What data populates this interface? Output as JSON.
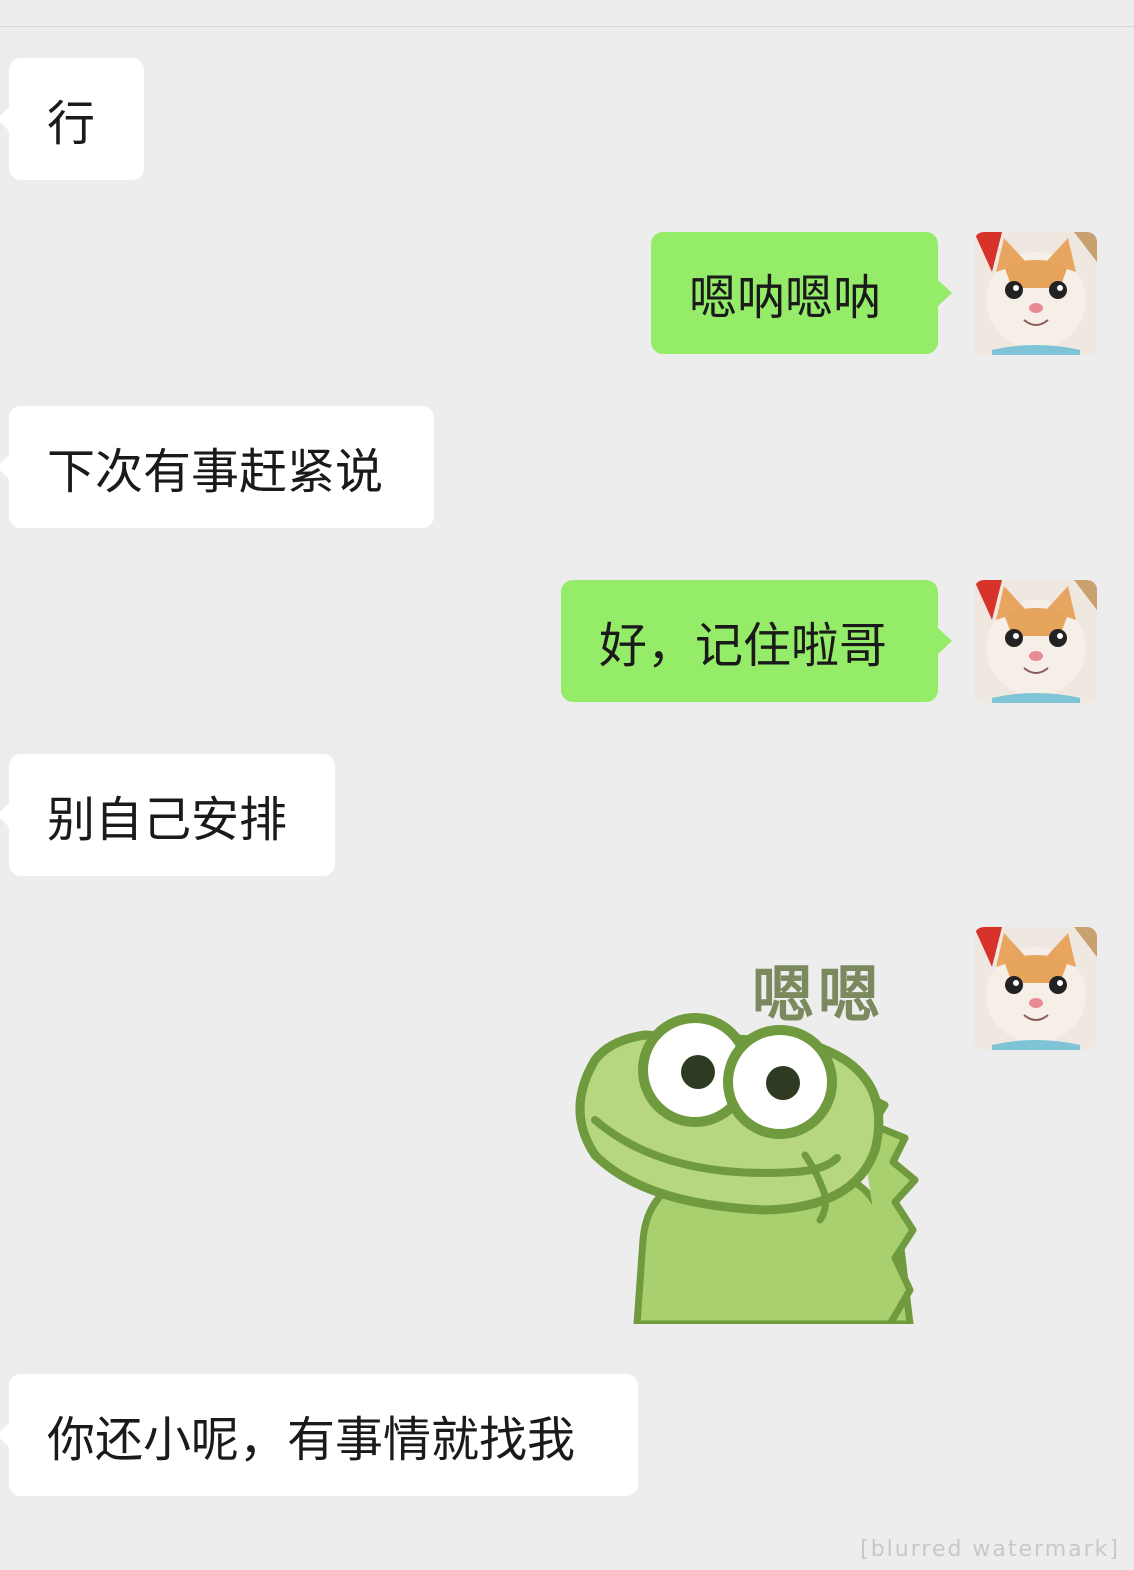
{
  "messages": [
    {
      "side": "left",
      "text": "行"
    },
    {
      "side": "right",
      "text": "嗯呐嗯呐"
    },
    {
      "side": "left",
      "text": "下次有事赶紧说"
    },
    {
      "side": "right",
      "text": "好，记住啦哥"
    },
    {
      "side": "left",
      "text": "别自己安排"
    },
    {
      "side": "right",
      "type": "sticker",
      "text": "嗯嗯"
    },
    {
      "side": "left",
      "text": "你还小呢，有事情就找我"
    }
  ],
  "watermark": "[blurred watermark]",
  "colors": {
    "background": "#ededed",
    "incoming": "#ffffff",
    "outgoing": "#95ec69"
  }
}
